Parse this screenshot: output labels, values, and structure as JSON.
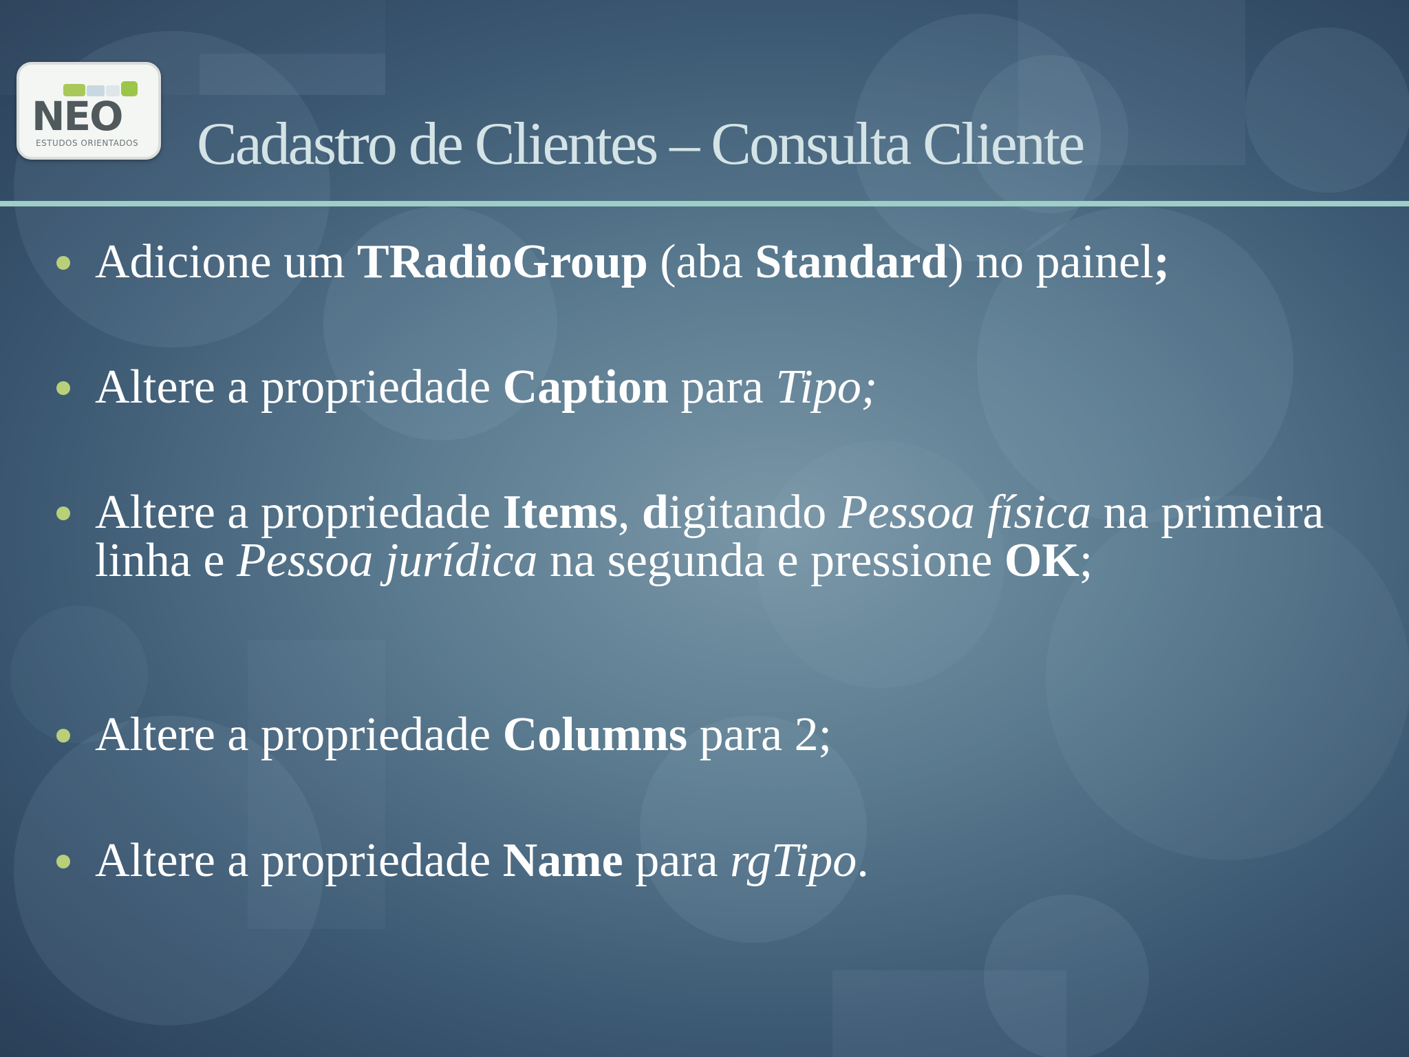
{
  "logo": {
    "word": "NEO",
    "subtitle": "ESTUDOS ORIENTADOS"
  },
  "title": "Cadastro de Clientes – Consulta Cliente",
  "bullets": [
    {
      "segments": [
        {
          "text": "Adicione um ",
          "style": "normal"
        },
        {
          "text": "TRadioGroup",
          "style": "bold"
        },
        {
          "text": " (aba ",
          "style": "normal"
        },
        {
          "text": "Standard",
          "style": "bold"
        },
        {
          "text": ") no painel",
          "style": "normal"
        },
        {
          "text": ";",
          "style": "bold"
        }
      ]
    },
    {
      "segments": [
        {
          "text": "Altere a propriedade ",
          "style": "normal"
        },
        {
          "text": "Caption",
          "style": "bold"
        },
        {
          "text": " para  ",
          "style": "normal"
        },
        {
          "text": "Tipo;",
          "style": "italic"
        }
      ]
    },
    {
      "segments": [
        {
          "text": "Altere a propriedade ",
          "style": "normal"
        },
        {
          "text": "Items",
          "style": "bold"
        },
        {
          "text": ", ",
          "style": "normal"
        },
        {
          "text": "d",
          "style": "bold"
        },
        {
          "text": "igitando ",
          "style": "normal"
        },
        {
          "text": "Pessoa física",
          "style": "italic"
        },
        {
          "text": " na primeira linha e ",
          "style": "normal"
        },
        {
          "text": "Pessoa jurídica",
          "style": "italic"
        },
        {
          "text": " na segunda e pressione ",
          "style": "normal"
        },
        {
          "text": "OK",
          "style": "bold"
        },
        {
          "text": ";",
          "style": "normal"
        }
      ]
    },
    {
      "segments": [
        {
          "text": "Altere a propriedade ",
          "style": "normal"
        },
        {
          "text": "Columns",
          "style": "bold"
        },
        {
          "text": " para 2;",
          "style": "normal"
        }
      ]
    },
    {
      "segments": [
        {
          "text": "Altere a propriedade ",
          "style": "normal"
        },
        {
          "text": "Name",
          "style": "bold"
        },
        {
          "text": " para ",
          "style": "normal"
        },
        {
          "text": "rgTipo",
          "style": "italic"
        },
        {
          "text": ".",
          "style": "normal"
        }
      ]
    }
  ],
  "colors": {
    "title": "#d4e4e6",
    "divider": "#9fcdc8",
    "bullet_dot": "#b8d07a",
    "text": "#ffffff"
  }
}
